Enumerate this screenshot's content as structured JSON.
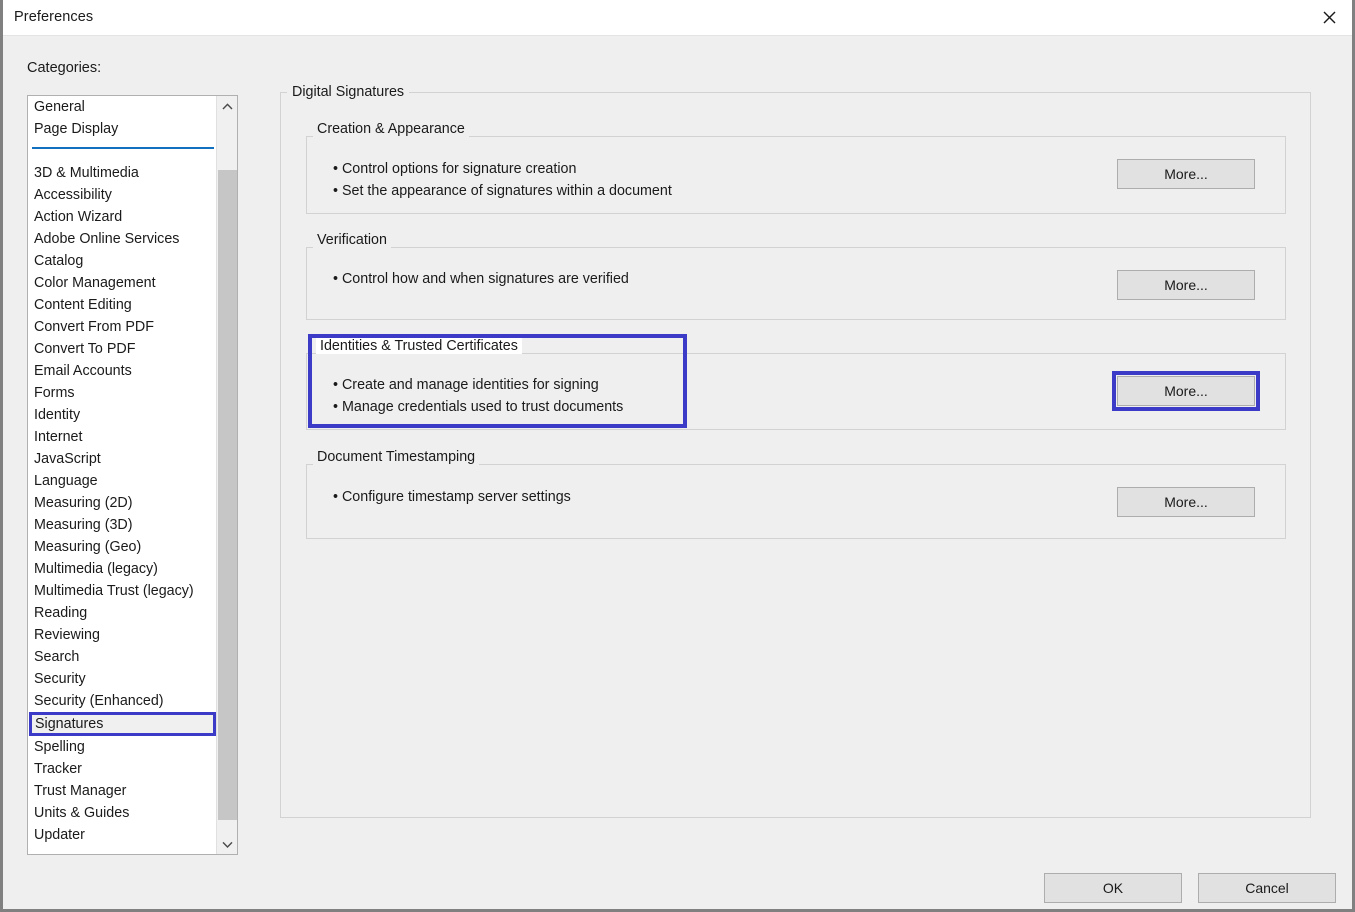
{
  "window": {
    "title": "Preferences",
    "close_icon": "close-icon"
  },
  "sidebar": {
    "label": "Categories:",
    "items": [
      {
        "label": "General",
        "selected": false
      },
      {
        "label": "Page Display",
        "selected": false
      },
      {
        "separator": true
      },
      {
        "label": "3D & Multimedia",
        "selected": false
      },
      {
        "label": "Accessibility",
        "selected": false
      },
      {
        "label": "Action Wizard",
        "selected": false
      },
      {
        "label": "Adobe Online Services",
        "selected": false
      },
      {
        "label": "Catalog",
        "selected": false
      },
      {
        "label": "Color Management",
        "selected": false
      },
      {
        "label": "Content Editing",
        "selected": false
      },
      {
        "label": "Convert From PDF",
        "selected": false
      },
      {
        "label": "Convert To PDF",
        "selected": false
      },
      {
        "label": "Email Accounts",
        "selected": false
      },
      {
        "label": "Forms",
        "selected": false
      },
      {
        "label": "Identity",
        "selected": false
      },
      {
        "label": "Internet",
        "selected": false
      },
      {
        "label": "JavaScript",
        "selected": false
      },
      {
        "label": "Language",
        "selected": false
      },
      {
        "label": "Measuring (2D)",
        "selected": false
      },
      {
        "label": "Measuring (3D)",
        "selected": false
      },
      {
        "label": "Measuring (Geo)",
        "selected": false
      },
      {
        "label": "Multimedia (legacy)",
        "selected": false
      },
      {
        "label": "Multimedia Trust (legacy)",
        "selected": false
      },
      {
        "label": "Reading",
        "selected": false
      },
      {
        "label": "Reviewing",
        "selected": false
      },
      {
        "label": "Search",
        "selected": false
      },
      {
        "label": "Security",
        "selected": false
      },
      {
        "label": "Security (Enhanced)",
        "selected": false
      },
      {
        "label": "Signatures",
        "selected": true
      },
      {
        "label": "Spelling",
        "selected": false
      },
      {
        "label": "Tracker",
        "selected": false
      },
      {
        "label": "Trust Manager",
        "selected": false
      },
      {
        "label": "Units & Guides",
        "selected": false
      },
      {
        "label": "Updater",
        "selected": false
      }
    ],
    "scrollbar": {
      "up_icon": "chevron-up-icon",
      "down_icon": "chevron-down-icon"
    }
  },
  "main": {
    "group_title": "Digital Signatures",
    "sections": [
      {
        "title": "Creation & Appearance",
        "bullets": [
          "• Control options for signature creation",
          "• Set the appearance of signatures within a document"
        ],
        "button": "More...",
        "highlighted": false
      },
      {
        "title": "Verification",
        "bullets": [
          "• Control how and when signatures are verified"
        ],
        "button": "More...",
        "highlighted": false
      },
      {
        "title": "Identities & Trusted Certificates",
        "bullets": [
          "• Create and manage identities for signing",
          "• Manage credentials used to trust documents"
        ],
        "button": "More...",
        "highlighted": true
      },
      {
        "title": "Document Timestamping",
        "bullets": [
          "• Configure timestamp server settings"
        ],
        "button": "More...",
        "highlighted": false
      }
    ]
  },
  "footer": {
    "ok_label": "OK",
    "cancel_label": "Cancel"
  },
  "colors": {
    "annotation": "#3b3bc8",
    "separator": "#1170bf",
    "dialog_bg": "#efefef",
    "button_bg": "#e1e1e1"
  }
}
